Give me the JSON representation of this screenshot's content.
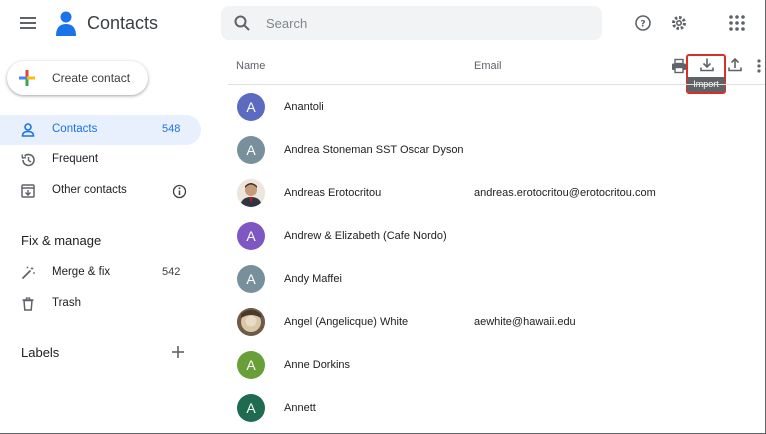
{
  "header": {
    "app_title": "Contacts",
    "search_placeholder": "Search"
  },
  "sidebar": {
    "create_label": "Create contact",
    "items": [
      {
        "label": "Contacts",
        "count": "548",
        "active": true,
        "icon": "person-icon"
      },
      {
        "label": "Frequent",
        "count": "",
        "active": false,
        "icon": "history-icon"
      },
      {
        "label": "Other contacts",
        "count": "",
        "active": false,
        "icon": "archive-download-icon"
      }
    ],
    "fix_manage_title": "Fix & manage",
    "fix_items": [
      {
        "label": "Merge & fix",
        "count": "542",
        "icon": "magic-wand-icon"
      },
      {
        "label": "Trash",
        "count": "",
        "icon": "trash-icon"
      }
    ],
    "labels_title": "Labels"
  },
  "list": {
    "name_header": "Name",
    "email_header": "Email",
    "tooltip": "Import",
    "rows": [
      {
        "initial": "A",
        "name": "Anantoli",
        "email": "",
        "avatar_color": "#5c6bc0"
      },
      {
        "initial": "A",
        "name": "Andrea Stoneman SST Oscar Dyson",
        "email": "",
        "avatar_color": "#78909c"
      },
      {
        "initial": "",
        "name": "Andreas Erotocritou",
        "email": "andreas.erotocritou@erotocritou.com",
        "avatar_color": "#8d6e63",
        "photo": true
      },
      {
        "initial": "A",
        "name": "Andrew & Elizabeth (Cafe Nordo)",
        "email": "",
        "avatar_color": "#7e57c2"
      },
      {
        "initial": "A",
        "name": "Andy Maffei",
        "email": "",
        "avatar_color": "#78909c"
      },
      {
        "initial": "",
        "name": "Angel (Angelicque) White",
        "email": "aewhite@hawaii.edu",
        "avatar_color": "#a1887f",
        "photo": true
      },
      {
        "initial": "A",
        "name": "Anne Dorkins",
        "email": "",
        "avatar_color": "#689f38"
      },
      {
        "initial": "A",
        "name": "Annett",
        "email": "",
        "avatar_color": "#1e6b4f"
      }
    ]
  }
}
